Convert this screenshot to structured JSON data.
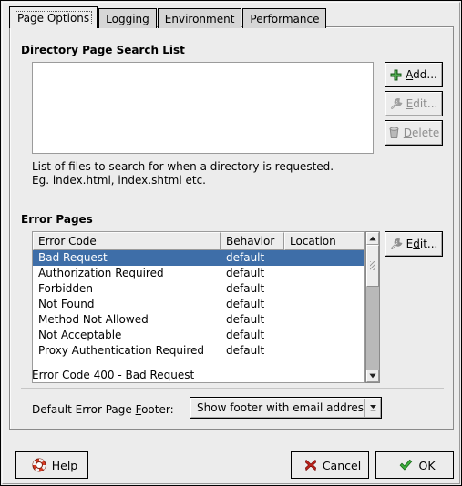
{
  "window": {
    "tabs": [
      {
        "label": "Page Options",
        "selected": true
      },
      {
        "label": "Logging",
        "selected": false
      },
      {
        "label": "Environment",
        "selected": false
      },
      {
        "label": "Performance",
        "selected": false
      }
    ]
  },
  "directory_section": {
    "title": "Directory Page Search List",
    "list_items": [],
    "buttons": [
      {
        "label": "Add...",
        "icon": "plus-icon",
        "enabled": true,
        "mnemonic": "A"
      },
      {
        "label": "Edit...",
        "icon": "wrench-icon",
        "enabled": false,
        "mnemonic": "E"
      },
      {
        "label": "Delete",
        "icon": "trash-icon",
        "enabled": false,
        "mnemonic": "D"
      }
    ],
    "help_line1": "List of files to search for when a directory is requested.",
    "help_line2": "Eg. index.html, index.shtml etc."
  },
  "error_section": {
    "title": "Error Pages",
    "columns": [
      "Error Code",
      "Behavior",
      "Location"
    ],
    "rows": [
      {
        "error_code": "Bad Request",
        "behavior": "default",
        "location": "",
        "selected": true
      },
      {
        "error_code": "Authorization Required",
        "behavior": "default",
        "location": "",
        "selected": false
      },
      {
        "error_code": "Forbidden",
        "behavior": "default",
        "location": "",
        "selected": false
      },
      {
        "error_code": "Not Found",
        "behavior": "default",
        "location": "",
        "selected": false
      },
      {
        "error_code": "Method Not Allowed",
        "behavior": "default",
        "location": "",
        "selected": false
      },
      {
        "error_code": "Not Acceptable",
        "behavior": "default",
        "location": "",
        "selected": false
      },
      {
        "error_code": "Proxy Authentication Required",
        "behavior": "default",
        "location": "",
        "selected": false
      }
    ],
    "edit_button": {
      "label": "Edit...",
      "icon": "wrench-icon",
      "enabled": true,
      "mnemonic": "t"
    },
    "status": "Error Code 400 - Bad Request",
    "footer_label_pre": "Default Error Page ",
    "footer_label_mnemonic": "F",
    "footer_label_post": "ooter:",
    "footer_value": "Show footer with email address"
  },
  "footer_buttons": {
    "help": {
      "label": "Help",
      "icon": "lifebuoy-icon",
      "mnemonic": "H"
    },
    "cancel": {
      "label": "Cancel",
      "icon": "x-icon",
      "mnemonic": "C"
    },
    "ok": {
      "label": "OK",
      "icon": "check-icon",
      "mnemonic": "O"
    }
  },
  "colors": {
    "window_bg": "#ececec",
    "selection_blue": "#3e6ea8",
    "add_green": "#2f8b2f",
    "cancel_red": "#c02020",
    "ok_green": "#3ba83b"
  }
}
